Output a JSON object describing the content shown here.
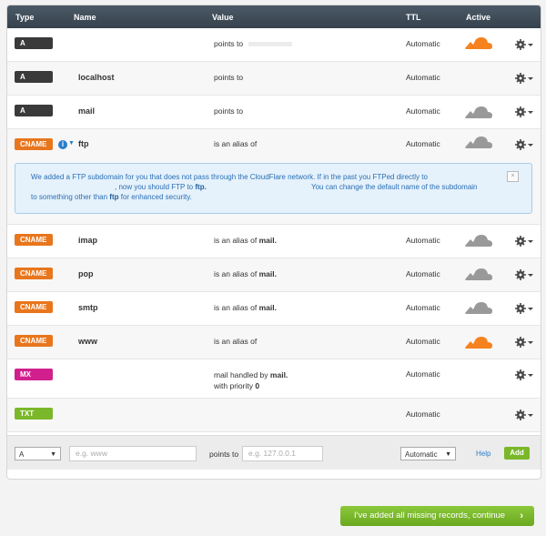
{
  "header": {
    "type": "Type",
    "name": "Name",
    "value": "Value",
    "ttl": "TTL",
    "active": "Active"
  },
  "colors": {
    "A": "#3a3a3a",
    "CNAME": "#e8761d",
    "MX": "#d1208e",
    "TXT": "#7ab829",
    "cloud_on": "#f6821f",
    "cloud_off": "#999999",
    "accent": "#2a7fc9"
  },
  "rows": [
    {
      "type": "A",
      "name": "",
      "value_prefix": "points to",
      "value_bold": "",
      "ttl": "Automatic",
      "cloud": "cloud-on-icon"
    },
    {
      "type": "A",
      "name": "localhost",
      "value_prefix": "points to",
      "value_bold": "",
      "ttl": "Automatic",
      "cloud": "none"
    },
    {
      "type": "A",
      "name": "mail",
      "value_prefix": "points to",
      "value_bold": "",
      "ttl": "Automatic",
      "cloud": "cloud-off-icon"
    },
    {
      "type": "CNAME",
      "name": "ftp",
      "value_prefix": "is an alias of",
      "value_bold": "",
      "ttl": "Automatic",
      "cloud": "cloud-off-icon"
    },
    {
      "type": "CNAME",
      "name": "imap",
      "value_prefix": "is an alias of",
      "value_bold": "mail.",
      "ttl": "Automatic",
      "cloud": "cloud-off-icon"
    },
    {
      "type": "CNAME",
      "name": "pop",
      "value_prefix": "is an alias of",
      "value_bold": "mail.",
      "ttl": "Automatic",
      "cloud": "cloud-off-icon"
    },
    {
      "type": "CNAME",
      "name": "smtp",
      "value_prefix": "is an alias of",
      "value_bold": "mail.",
      "ttl": "Automatic",
      "cloud": "cloud-off-icon"
    },
    {
      "type": "CNAME",
      "name": "www",
      "value_prefix": "is an alias of",
      "value_bold": "",
      "ttl": "Automatic",
      "cloud": "cloud-on-icon"
    },
    {
      "type": "MX",
      "name": "",
      "value_prefix": "mail handled by",
      "value_bold": "mail.",
      "value_line2_prefix": "with priority",
      "value_line2_bold": "0",
      "ttl": "Automatic",
      "cloud": "none"
    },
    {
      "type": "TXT",
      "name": "",
      "value_prefix": "",
      "value_bold": "",
      "ttl": "Automatic",
      "cloud": "none"
    }
  ],
  "notice": {
    "text1": "We added a FTP subdomain for you that does not pass through the CloudFlare network. If in the past you FTPed directly to",
    "text2": ", now you should FTP to",
    "text2_bold": "ftp.",
    "text3": "You can change the default name of the subdomain",
    "text4": "to something other than",
    "text4_bold": "ftp",
    "text5": "for enhanced security.",
    "close": "×"
  },
  "add_record": {
    "type_selected": "A",
    "name_placeholder": "e.g. www",
    "points_to_label": "points to",
    "value_placeholder": "e.g. 127.0.0.1",
    "ttl_selected": "Automatic",
    "help": "Help",
    "add": "Add"
  },
  "continue_button": "I've added all missing records, continue"
}
